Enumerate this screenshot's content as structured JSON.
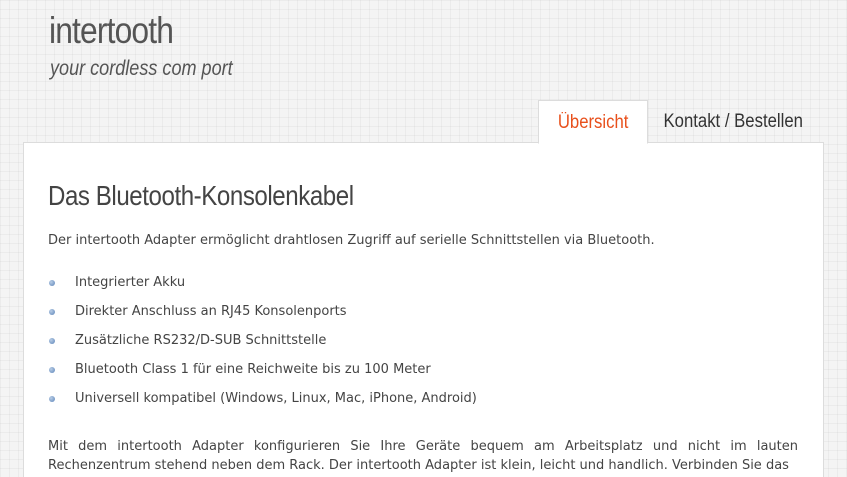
{
  "site": {
    "title": "intertooth",
    "tagline": "your cordless com port"
  },
  "nav": {
    "tabs": [
      {
        "label": "Übersicht",
        "active": true
      },
      {
        "label": "Kontakt / Bestellen",
        "active": false
      }
    ]
  },
  "main": {
    "heading": "Das Bluetooth-Konsolenkabel",
    "intro": "Der intertooth Adapter ermöglicht drahtlosen Zugriff auf serielle Schnittstellen via Bluetooth.",
    "features": [
      "Integrierter Akku",
      "Direkter Anschluss an RJ45 Konsolenports",
      "Zusätzliche RS232/D-SUB Schnittstelle",
      "Bluetooth Class 1 für eine Reichweite bis zu 100 Meter",
      "Universell kompatibel (Windows, Linux, Mac, iPhone, Android)"
    ],
    "paragraph": "Mit dem intertooth Adapter konfigurieren Sie Ihre Geräte bequem am Arbeitsplatz und nicht im lauten Rechenzentrum stehend neben dem Rack. Der intertooth Adapter ist klein, leicht und handlich. Verbinden Sie das"
  },
  "colors": {
    "accent": "#e8501c",
    "bullet": "#5c84b8"
  }
}
